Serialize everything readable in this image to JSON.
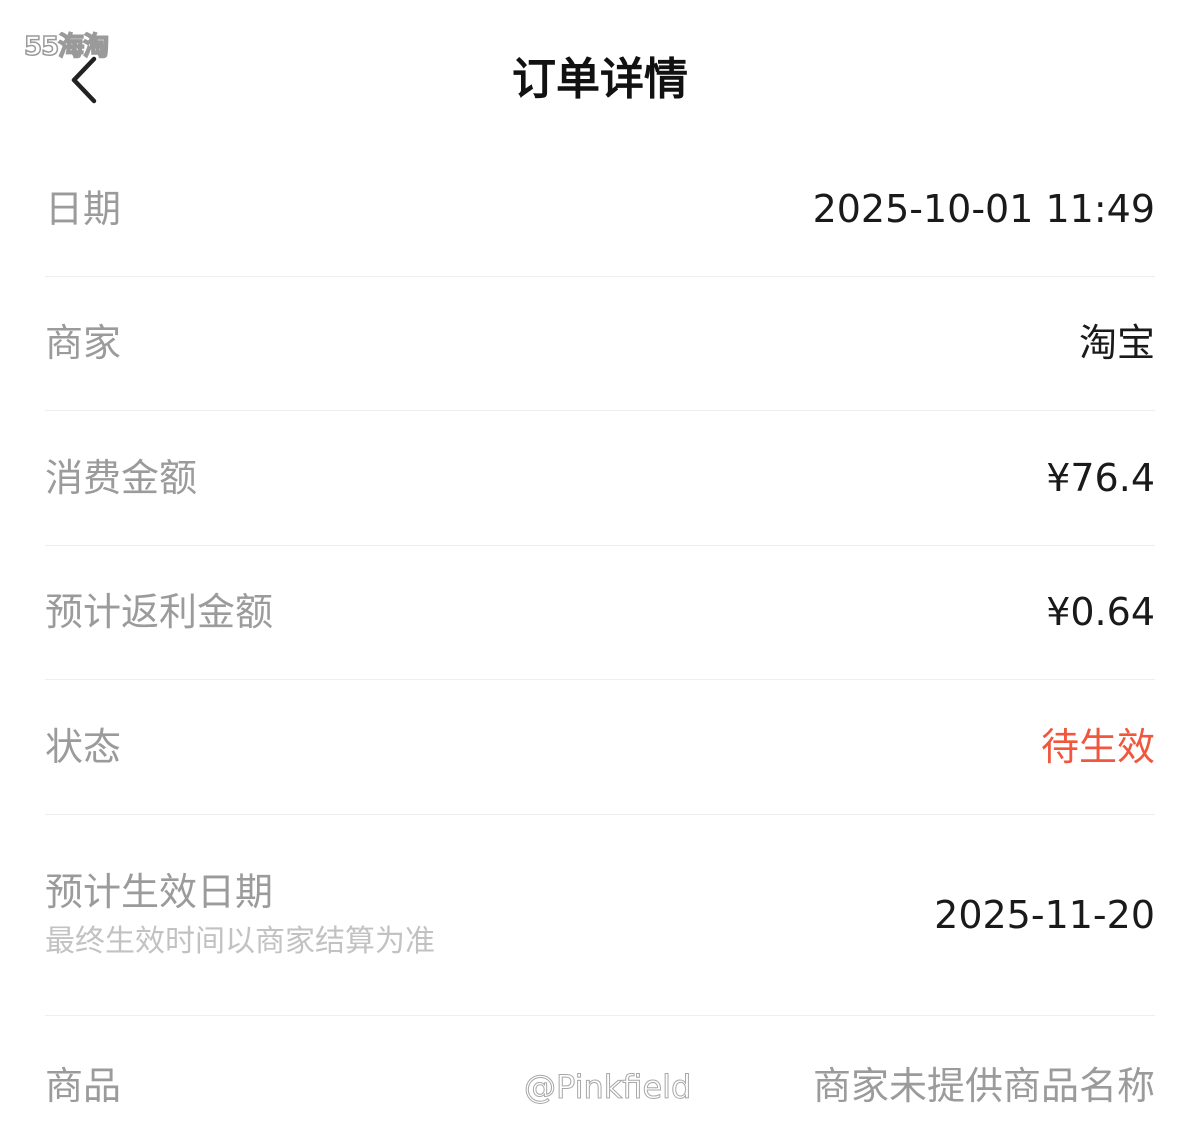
{
  "watermark": {
    "top": "55海淘",
    "bottom": "@Pinkfield"
  },
  "header": {
    "title": "订单详情",
    "back_icon": "chevron-left-icon"
  },
  "rows": [
    {
      "label": "日期",
      "value": "2025-10-01 11:49"
    },
    {
      "label": "商家",
      "value": "淘宝"
    },
    {
      "label": "消费金额",
      "value": "¥76.4"
    },
    {
      "label": "预计返利金额",
      "value": "¥0.64"
    },
    {
      "label": "状态",
      "value": "待生效"
    },
    {
      "label": "预计生效日期",
      "sublabel": "最终生效时间以商家结算为准",
      "value": "2025-11-20"
    },
    {
      "label": "商品",
      "value": "商家未提供商品名称"
    }
  ],
  "colors": {
    "status": "#f0573d",
    "label": "#9b9b9b",
    "value": "#1a1a1a",
    "divider": "#eeeeee"
  }
}
